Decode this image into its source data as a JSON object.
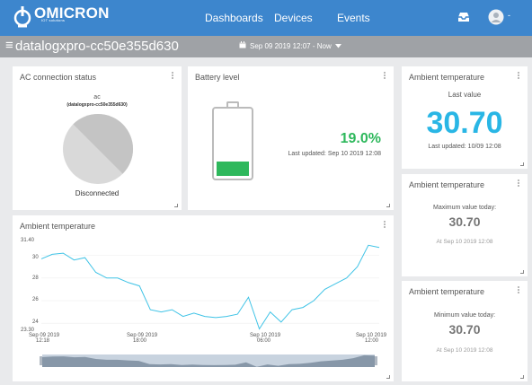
{
  "nav": {
    "brand": "OMICRON",
    "brand_sub": "IOT solutions",
    "items": [
      "Dashboards",
      "Devices",
      "Events"
    ]
  },
  "subbar": {
    "device_name": "datalogxpro-cc50e355d630",
    "date_range": "Sep 09 2019 12:07 - Now"
  },
  "ac_status": {
    "title": "AC connection status",
    "label": "ac",
    "device": "(datalogxpro-cc50e355d630)",
    "state": "Disconnected"
  },
  "battery": {
    "title": "Battery level",
    "percent_text": "19.0%",
    "level": 0.19,
    "updated": "Last updated: Sep 10 2019 12:08",
    "color": "#2eb85c"
  },
  "temp_last": {
    "title": "Ambient temperature",
    "caption": "Last value",
    "value": "30.70",
    "updated": "Last updated: 10/09 12:08",
    "color": "#29b6e5"
  },
  "temp_max": {
    "title": "Ambient temperature",
    "caption": "Maximum value today:",
    "value": "30.70",
    "when": "At Sep 10 2019 12:08"
  },
  "temp_min": {
    "title": "Ambient temperature",
    "caption": "Minimum value today:",
    "value": "30.70",
    "when": "At Sep 10 2019 12:08"
  },
  "temp_chart": {
    "title": "Ambient temperature",
    "y_min_label": "23.30",
    "y_max_label": "31.40",
    "y_ticks": [
      "30",
      "28",
      "26",
      "24"
    ],
    "x_ticks": [
      {
        "line1": "Sep 09 2019",
        "line2": "12:18"
      },
      {
        "line1": "Sep 09 2019",
        "line2": "18:00"
      },
      {
        "line1": "Sep 10 2019",
        "line2": "06:00"
      },
      {
        "line1": "Sep 10 2019",
        "line2": "12:00"
      }
    ]
  },
  "chart_data": {
    "type": "line",
    "title": "Ambient temperature",
    "ylim": [
      23.3,
      31.4
    ],
    "x": [
      "Sep 09 12:18",
      "Sep 09 13:00",
      "Sep 09 14:00",
      "Sep 09 15:00",
      "Sep 09 16:00",
      "Sep 09 17:00",
      "Sep 09 18:00",
      "Sep 09 19:00",
      "Sep 09 20:00",
      "Sep 09 21:00",
      "Sep 09 22:00",
      "Sep 09 23:00",
      "Sep 10 00:00",
      "Sep 10 01:00",
      "Sep 10 02:00",
      "Sep 10 03:00",
      "Sep 10 04:00",
      "Sep 10 05:00",
      "Sep 10 06:00",
      "Sep 10 06:30",
      "Sep 10 07:00",
      "Sep 10 07:30",
      "Sep 10 08:00",
      "Sep 10 08:30",
      "Sep 10 09:00",
      "Sep 10 09:30",
      "Sep 10 10:00",
      "Sep 10 10:30",
      "Sep 10 11:00",
      "Sep 10 11:30",
      "Sep 10 12:00",
      "Sep 10 12:08"
    ],
    "series": [
      {
        "values": [
          29.7,
          30.1,
          30.2,
          29.6,
          29.8,
          28.5,
          28.0,
          28.0,
          27.6,
          27.3,
          25.2,
          25.0,
          25.2,
          24.6,
          24.9,
          24.6,
          24.5,
          24.6,
          24.8,
          26.3,
          23.5,
          25.0,
          24.1,
          25.2,
          25.4,
          26.0,
          27.0,
          27.5,
          28.0,
          29.0,
          30.9,
          30.7
        ]
      }
    ]
  }
}
